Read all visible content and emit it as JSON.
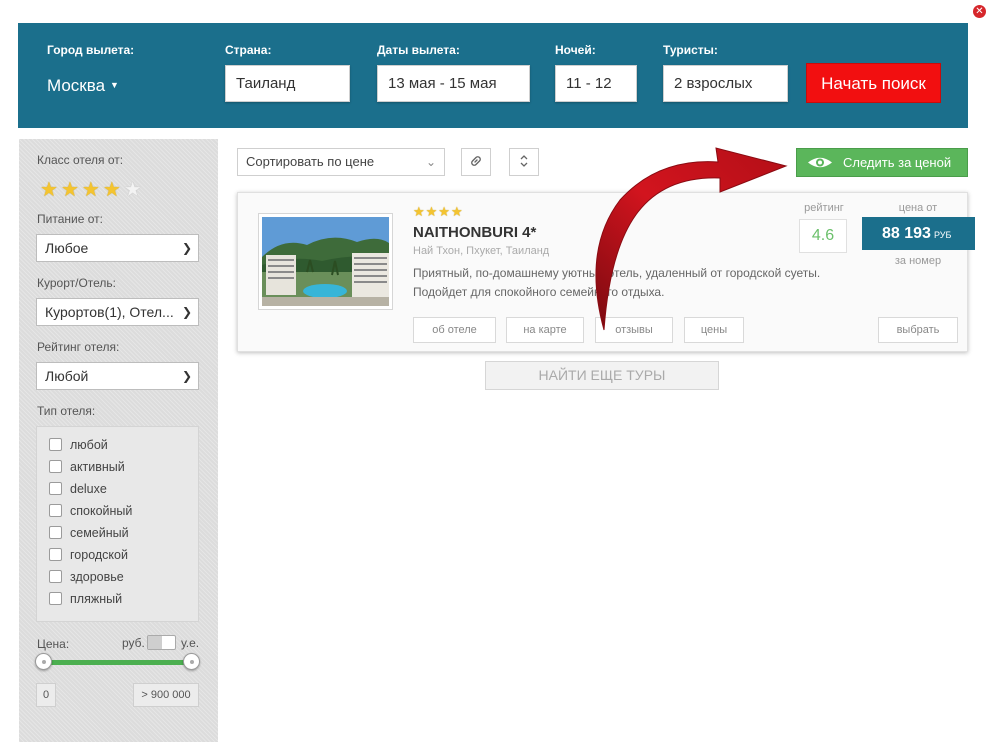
{
  "header": {
    "city_label": "Город вылета:",
    "city_value": "Москва",
    "country_label": "Страна:",
    "country_value": "Таиланд",
    "dates_label": "Даты вылета:",
    "dates_value": "13 мая - 15 мая",
    "nights_label": "Ночей:",
    "nights_value": "11 - 12",
    "tourists_label": "Туристы:",
    "tourists_value": "2 взрослых",
    "search_button": "Начать поиск"
  },
  "sidebar": {
    "hotel_class_label": "Класс отеля от:",
    "hotel_class_stars": 4,
    "meal_label": "Питание от:",
    "meal_value": "Любое",
    "resort_label": "Курорт/Отель:",
    "resort_value": "Курортов(1), Отел...",
    "rating_label": "Рейтинг отеля:",
    "rating_value": "Любой",
    "type_label": "Тип отеля:",
    "types": [
      "любой",
      "активный",
      "deluxe",
      "спокойный",
      "семейный",
      "городской",
      "здоровье",
      "пляжный"
    ],
    "price_label": "Цена:",
    "currency_rub": "руб.",
    "currency_ue": "у.е.",
    "price_min": "0",
    "price_max": "> 900 000"
  },
  "toolbar": {
    "sort_value": "Сортировать по цене",
    "watch_price_button": "Следить за ценой"
  },
  "hotel": {
    "stars": 4,
    "name": "NAITHONBURI 4*",
    "location": "Най Тхон, Пхукет, Таиланд",
    "description": "Приятный, по-домашнему уютный отель, удаленный от городской суеты. Подойдет для спокойного семейного отдыха.",
    "rating_label": "рейтинг",
    "rating_value": "4.6",
    "price_from_label": "цена от",
    "price_value": "88 193",
    "price_currency": "РУБ",
    "per_room_label": "за номер",
    "buttons": {
      "about": "об отеле",
      "map": "на карте",
      "reviews": "отзывы",
      "prices": "цены",
      "choose": "выбрать"
    }
  },
  "more_button": "НАЙТИ ЕЩЕ ТУРЫ",
  "colors": {
    "header_bg": "#1b6f8c",
    "search_button": "#f20f10",
    "watch_button": "#5bb65b",
    "price_box": "#1b6f8c",
    "rating_text": "#6bc06b",
    "arrow": "#c8101b"
  }
}
